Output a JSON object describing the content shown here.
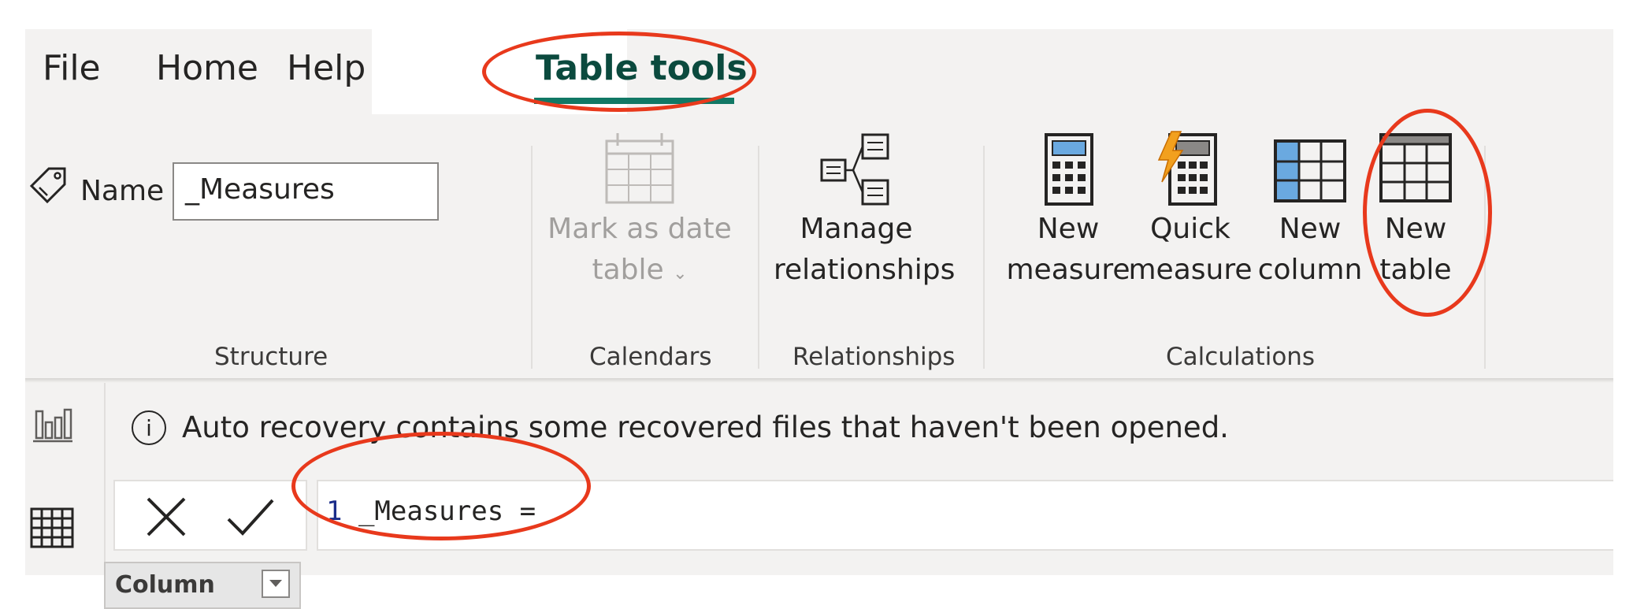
{
  "tabs": {
    "file": "File",
    "home": "Home",
    "help": "Help",
    "table_tools": "Table tools"
  },
  "structure": {
    "name_label": "Name",
    "name_value": "_Measures",
    "group_label": "Structure"
  },
  "calendars": {
    "button_line1": "Mark as date",
    "button_line2": "table",
    "group_label": "Calendars"
  },
  "relationships": {
    "button_line1": "Manage",
    "button_line2": "relationships",
    "group_label": "Relationships"
  },
  "calculations": {
    "new_measure": [
      "New",
      "measure"
    ],
    "quick_measure": [
      "Quick",
      "measure"
    ],
    "new_column": [
      "New",
      "column"
    ],
    "new_table": [
      "New",
      "table"
    ],
    "group_label": "Calculations"
  },
  "notification": {
    "icon": "info-icon",
    "text": "Auto recovery contains some recovered files that haven't been opened."
  },
  "formula_bar": {
    "line_number": "1",
    "code": " _Measures ="
  },
  "table_header": {
    "column_label": "Column"
  },
  "colors": {
    "accent": "#117865",
    "annotation": "#e8391c",
    "ribbon_bg": "#f3f2f1"
  }
}
